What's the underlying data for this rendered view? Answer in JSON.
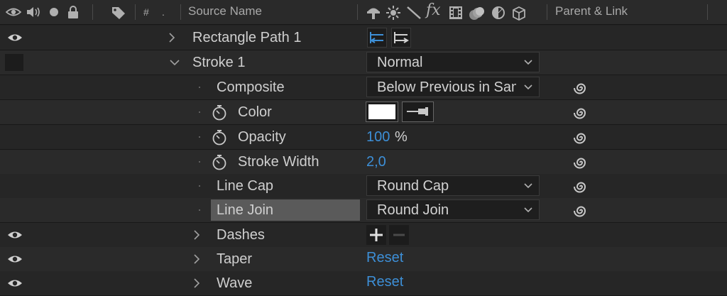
{
  "header": {
    "hash": "#",
    "dot": ".",
    "source_name": "Source Name",
    "parent_link": "Parent & Link"
  },
  "rows": [
    {
      "label": "Rectangle Path 1"
    },
    {
      "label": "Stroke 1",
      "value": "Normal"
    },
    {
      "label": "Composite",
      "value": "Below Previous in Same Group"
    },
    {
      "label": "Color",
      "value": "#ffffff"
    },
    {
      "label": "Opacity",
      "value": "100",
      "unit": "%"
    },
    {
      "label": "Stroke Width",
      "value": "2,0"
    },
    {
      "label": "Line Cap",
      "value": "Round Cap"
    },
    {
      "label": "Line Join",
      "value": "Round Join"
    },
    {
      "label": "Dashes"
    },
    {
      "label": "Taper",
      "value": "Reset"
    },
    {
      "label": "Wave",
      "value": "Reset"
    }
  ],
  "colors": {
    "accent": "#3d8fd7",
    "background": "#232323",
    "header": "#2a2a2a"
  }
}
